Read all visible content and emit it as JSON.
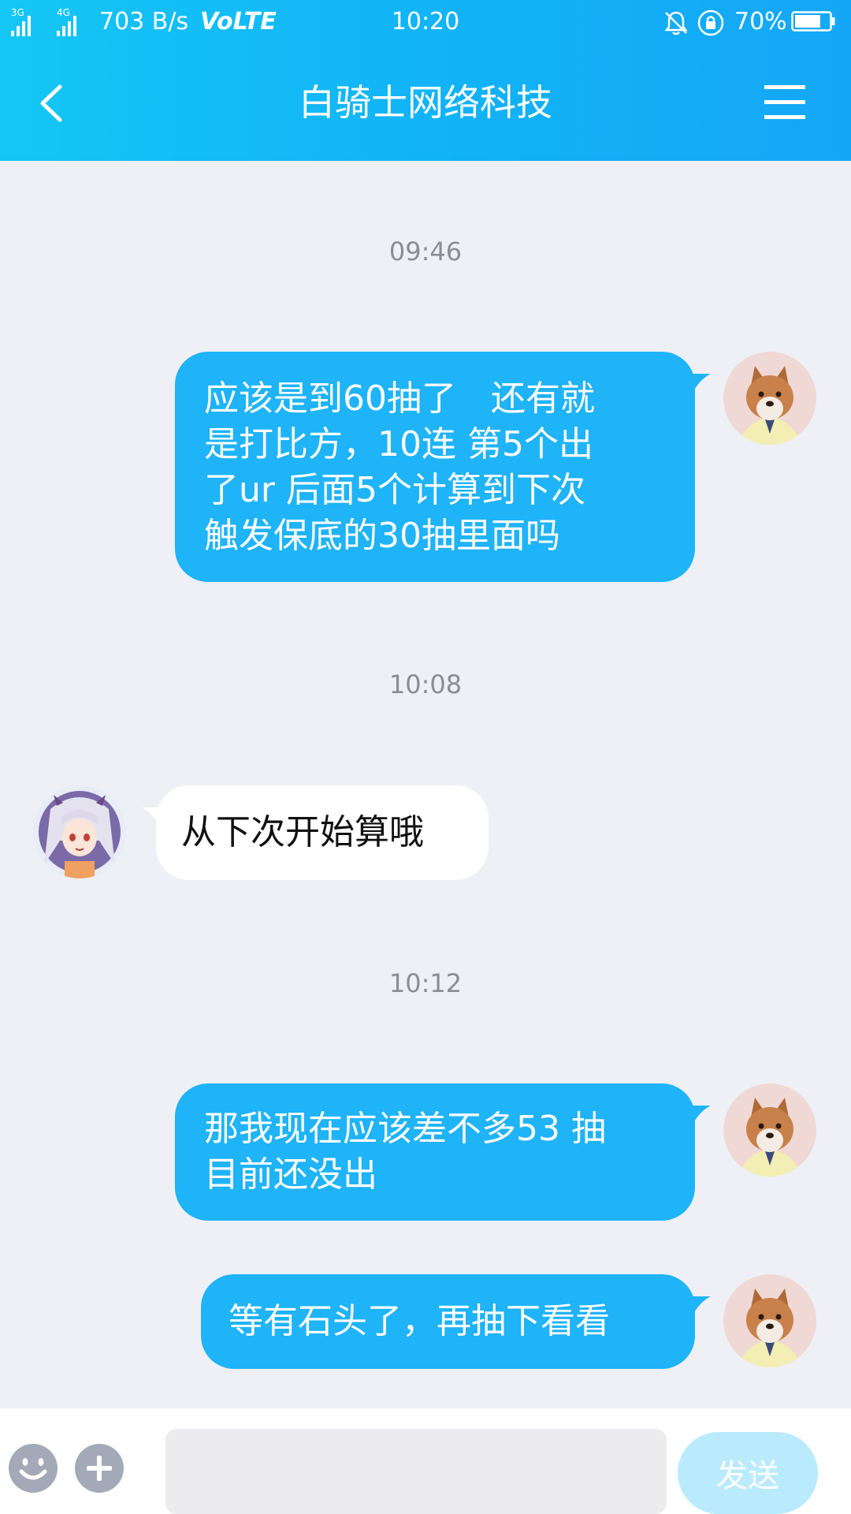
{
  "status_bar": {
    "net1": "3G",
    "net2": "4G",
    "speed": "703 B/s",
    "volte": "VoLTE",
    "time": "10:20",
    "battery": "70%"
  },
  "header": {
    "title": "白骑士网络科技",
    "background": "#14b6f7"
  },
  "messages": [
    {
      "type": "timestamp",
      "text": "09:46"
    },
    {
      "type": "message",
      "from": "me",
      "lines": [
        "应该是到60抽了　还有就",
        "是打比方，10连 第5个出",
        "了ur  后面5个计算到下次",
        "触发保底的30抽里面吗"
      ]
    },
    {
      "type": "timestamp",
      "text": "10:08"
    },
    {
      "type": "message",
      "from": "other",
      "lines": [
        "从下次开始算哦"
      ]
    },
    {
      "type": "timestamp",
      "text": "10:12"
    },
    {
      "type": "message",
      "from": "me",
      "lines": [
        "那我现在应该差不多53  抽",
        "目前还没出"
      ]
    },
    {
      "type": "message",
      "from": "me",
      "lines": [
        "等有石头了，再抽下看看"
      ]
    }
  ],
  "input_bar": {
    "input_value": "",
    "send_label": "发送"
  },
  "colors": {
    "my_bubble": "#1fb3f8",
    "other_bubble": "#ffffff",
    "chat_background": "#eff0f6",
    "send_button": "#b9ebfd"
  }
}
